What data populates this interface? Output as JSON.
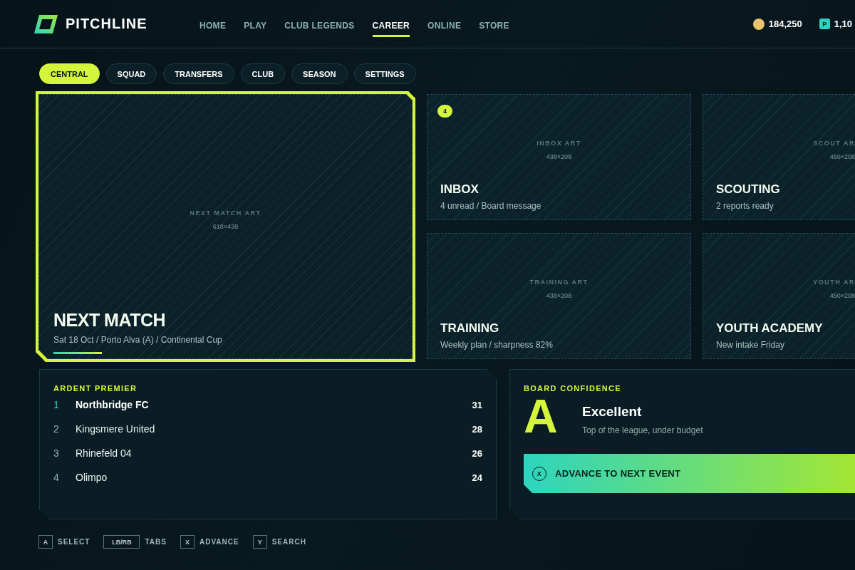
{
  "header": {
    "logo": "PITCHLINE",
    "nav": [
      {
        "label": "HOME",
        "selected": false
      },
      {
        "label": "PLAY",
        "selected": false
      },
      {
        "label": "CLUB LEGENDS",
        "selected": false
      },
      {
        "label": "CAREER",
        "selected": true
      },
      {
        "label": "ONLINE",
        "selected": false
      },
      {
        "label": "STORE",
        "selected": false
      }
    ],
    "currencies": [
      {
        "kind": "coins",
        "amount": "184,250"
      },
      {
        "kind": "points",
        "symbol": "P",
        "amount": "1,10"
      }
    ]
  },
  "tabs": [
    {
      "label": "CENTRAL",
      "selected": true
    },
    {
      "label": "SQUAD",
      "selected": false
    },
    {
      "label": "TRANSFERS",
      "selected": false
    },
    {
      "label": "CLUB",
      "selected": false
    },
    {
      "label": "SEASON",
      "selected": false
    },
    {
      "label": "SETTINGS",
      "selected": false
    }
  ],
  "tiles": [
    {
      "title": "NEXT MATCH",
      "subtitle": "Sat 18 Oct / Porto Alva (A) / Continental Cup",
      "art_label": "NEXT MATCH ART",
      "art_size": "618×438",
      "selected": true
    },
    {
      "title": "INBOX",
      "subtitle": "4 unread / Board message",
      "art_label": "INBOX ART",
      "art_size": "438×208",
      "badge": "4",
      "selected": false
    },
    {
      "title": "SCOUTING",
      "subtitle": "2 reports ready",
      "art_label": "SCOUT AR",
      "art_size": "450×208",
      "selected": false
    },
    {
      "title": "TRAINING",
      "subtitle": "Weekly plan / sharpness 82%",
      "art_label": "TRAINING ART",
      "art_size": "438×208",
      "selected": false
    },
    {
      "title": "YOUTH ACADEMY",
      "subtitle": "New intake Friday",
      "art_label": "YOUTH AR",
      "art_size": "450×208",
      "selected": false
    }
  ],
  "league": {
    "title": "ARDENT PREMIER",
    "rows": [
      {
        "rank": "1",
        "team": "Northbridge FC",
        "points": "31",
        "highlighted": true
      },
      {
        "rank": "2",
        "team": "Kingsmere United",
        "points": "28",
        "highlighted": false
      },
      {
        "rank": "3",
        "team": "Rhinefeld 04",
        "points": "26",
        "highlighted": false
      },
      {
        "rank": "4",
        "team": "Olimpo",
        "points": "24",
        "highlighted": false
      }
    ]
  },
  "board": {
    "label": "BOARD CONFIDENCE",
    "grade": "A",
    "rating": "Excellent",
    "note": "Top of the league, under budget",
    "action": {
      "key": "X",
      "label": "ADVANCE TO NEXT EVENT"
    }
  },
  "hints": [
    {
      "key": "A",
      "label": "SELECT"
    },
    {
      "key": "LB/RB",
      "label": "TABS"
    },
    {
      "key": "X",
      "label": "ADVANCE"
    },
    {
      "key": "Y",
      "label": "SEARCH"
    }
  ]
}
